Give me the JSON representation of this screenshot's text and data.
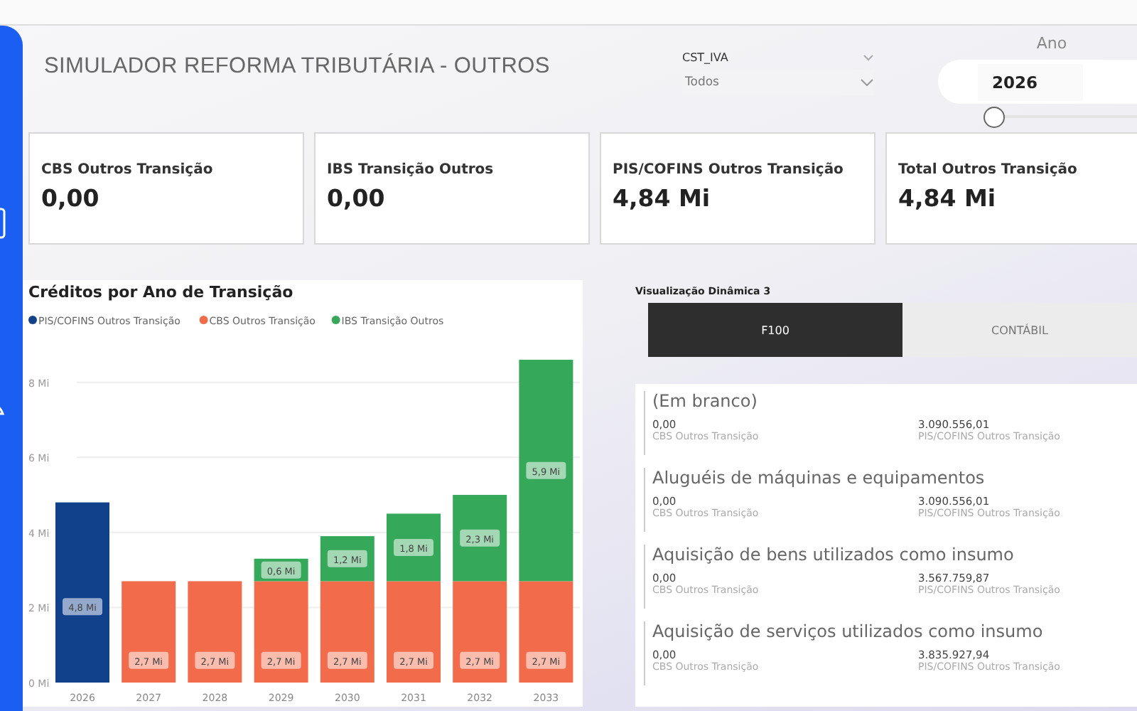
{
  "title": "SIMULADOR REFORMA TRIBUTÁRIA - OUTROS",
  "filter": {
    "label": "CST_IVA",
    "value": "Todos"
  },
  "year_slider": {
    "label": "Ano",
    "value": "2026",
    "level": 0
  },
  "kpis": [
    {
      "label": "CBS Outros Transição",
      "value": "0,00"
    },
    {
      "label": "IBS Transição Outros",
      "value": "0,00"
    },
    {
      "label": "PIS/COFINS Outros Transição",
      "value": "4,84 Mi"
    },
    {
      "label": "Total Outros Transição",
      "value": "4,84 Mi"
    }
  ],
  "chart": {
    "chart_data": {
      "type": "bar",
      "title": "Créditos por Ano de Transição",
      "stacked": true,
      "categories": [
        "2026",
        "2027",
        "2028",
        "2029",
        "2030",
        "2031",
        "2032",
        "2033"
      ],
      "series": [
        {
          "name": "PIS/COFINS Outros Transição",
          "color": "#12418c",
          "values": [
            4.8,
            null,
            null,
            null,
            null,
            null,
            null,
            null
          ]
        },
        {
          "name": "CBS Outros Transição",
          "color": "#f26b4a",
          "values": [
            null,
            2.7,
            2.7,
            2.7,
            2.7,
            2.7,
            2.7,
            2.7
          ]
        },
        {
          "name": "IBS Transição Outros",
          "color": "#35a85a",
          "values": [
            null,
            null,
            null,
            0.6,
            1.2,
            1.8,
            2.3,
            5.9
          ]
        }
      ],
      "grid": true,
      "legend": true,
      "ylim": [
        0,
        8.6
      ],
      "yticks": [
        {
          "value": 0,
          "label": "0 Mi"
        },
        {
          "value": 2,
          "label": "2 Mi"
        },
        {
          "value": 4,
          "label": "4 Mi"
        },
        {
          "value": 6,
          "label": "6 Mi"
        },
        {
          "value": 8,
          "label": "8 Mi"
        }
      ],
      "value_labels": [
        [
          "4,8 Mi",
          null,
          null,
          null,
          null,
          null,
          null,
          null
        ],
        [
          null,
          "2,7 Mi",
          "2,7 Mi",
          "2,7 Mi",
          "2,7 Mi",
          "2,7 Mi",
          "2,7 Mi",
          "2,7 Mi"
        ],
        [
          null,
          null,
          null,
          "0,6 Mi",
          "1,2 Mi",
          "1,8 Mi",
          "2,3 Mi",
          "5,9 Mi"
        ]
      ]
    }
  },
  "panel": {
    "title": "Visualização Dinâmica 3",
    "tabs": [
      {
        "label": "F100",
        "selected": true
      },
      {
        "label": "CONTÁBIL",
        "selected": false
      }
    ],
    "items": [
      {
        "name": "(Em branco)",
        "cbs_value": "0,00",
        "cbs_label": "CBS Outros Transição",
        "pis_value": "3.090.556,01",
        "pis_label": "PIS/COFINS Outros Transição"
      },
      {
        "name": "Aluguéis de máquinas e equipamentos",
        "cbs_value": "0,00",
        "cbs_label": "CBS Outros Transição",
        "pis_value": "3.090.556,01",
        "pis_label": "PIS/COFINS Outros Transição"
      },
      {
        "name": "Aquisição de bens utilizados como insumo",
        "cbs_value": "0,00",
        "cbs_label": "CBS Outros Transição",
        "pis_value": "3.567.759,87",
        "pis_label": "PIS/COFINS Outros Transição"
      },
      {
        "name": "Aquisição de serviços utilizados como insumo",
        "cbs_value": "0,00",
        "cbs_label": "CBS Outros Transição",
        "pis_value": "3.835.927,94",
        "pis_label": "PIS/COFINS Outros Transição"
      }
    ]
  }
}
